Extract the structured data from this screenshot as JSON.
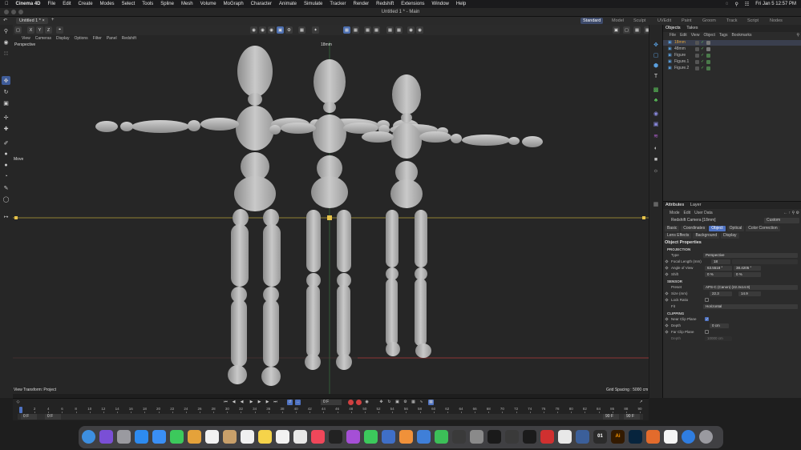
{
  "menubar": {
    "app_name": "Cinema 4D",
    "items": [
      "File",
      "Edit",
      "Create",
      "Modes",
      "Select",
      "Tools",
      "Spline",
      "Mesh",
      "Volume",
      "MoGraph",
      "Character",
      "Animate",
      "Simulate",
      "Tracker",
      "Render",
      "Redshift",
      "Extensions",
      "Window",
      "Help"
    ],
    "clock": "Fri Jan 5  12:57 PM"
  },
  "window": {
    "title": "Untitled 1 * - Main"
  },
  "doc_tab": {
    "label": "Untitled 1 *",
    "add": "+"
  },
  "layout_tabs": [
    "Standard",
    "Model",
    "Sculpt",
    "UVEdit",
    "Paint",
    "Groom",
    "Track",
    "Script",
    "Nodes"
  ],
  "active_layout": "Standard",
  "axis_buttons": [
    "X",
    "Y",
    "Z"
  ],
  "viewport_menu": [
    "View",
    "Cameras",
    "Display",
    "Options",
    "Filter",
    "Panel",
    "Redshift"
  ],
  "viewport": {
    "label": "Perspective",
    "camera_label": "18mm",
    "tool_label": "Move",
    "transform_label": "View Transform: Project",
    "grid_spacing": "Grid Spacing : 5000 cm"
  },
  "objects_panel": {
    "tabs": [
      "Objects",
      "Takes"
    ],
    "menu": [
      "File",
      "Edit",
      "View",
      "Object",
      "Tags",
      "Bookmarks"
    ],
    "items": [
      {
        "name": "18mm",
        "selected": true,
        "color": "#e0a33a"
      },
      {
        "name": "48mm",
        "selected": false,
        "color": "#bbbbbb"
      },
      {
        "name": "Figure",
        "selected": false,
        "color": "#bbbbbb"
      },
      {
        "name": "Figure.1",
        "selected": false,
        "color": "#bbbbbb"
      },
      {
        "name": "Figure.2",
        "selected": false,
        "color": "#bbbbbb"
      }
    ]
  },
  "attributes_panel": {
    "tabs": [
      "Attributes",
      "Layer"
    ],
    "menu": [
      "Mode",
      "Edit",
      "User Data"
    ],
    "object_title": "Redshift Camera [18mm]",
    "custom_select": "Custom",
    "property_tabs_row1": [
      "Basic",
      "Coordinates",
      "Object",
      "Optical",
      "Color Correction"
    ],
    "property_tabs_row2": [
      "Lens Effects",
      "Background",
      "Display"
    ],
    "active_tab": "Object",
    "section_title": "Object Properties",
    "projection": {
      "heading": "PROJECTION",
      "type_label": "Type",
      "type_value": "Perspective",
      "focal_label": "Focal Length (mm)",
      "focal_value": "18",
      "aov_label": "Angle of View",
      "aov_value_1": "63.5518 °",
      "aov_value_2": "38.4205 °",
      "shift_label": "Shift",
      "shift_value_1": "0 %",
      "shift_value_2": "0 %"
    },
    "sensor": {
      "heading": "SENSOR",
      "preset_label": "Preset",
      "preset_value": "APS-C (Canon) (22.3x14.9)",
      "size_label": "Size (mm)",
      "size_value_1": "22.3",
      "size_value_2": "14.9",
      "lock_label": "Lock Ratio",
      "fit_label": "Fit",
      "fit_value": "Horizontal"
    },
    "clipping": {
      "heading": "CLIPPING",
      "near_label": "Near Clip Plane",
      "depth_label": "Depth",
      "depth_value": "0 cm",
      "far_label": "Far Clip Plane",
      "far_depth_label": "Depth",
      "far_depth_value": "10000 cm"
    }
  },
  "timeline": {
    "current_frame": "0 F",
    "ticks": [
      "0",
      "2",
      "4",
      "6",
      "8",
      "10",
      "12",
      "14",
      "16",
      "18",
      "20",
      "22",
      "24",
      "26",
      "28",
      "30",
      "32",
      "34",
      "36",
      "38",
      "40",
      "42",
      "44",
      "46",
      "48",
      "50",
      "52",
      "54",
      "56",
      "58",
      "60",
      "62",
      "64",
      "66",
      "68",
      "70",
      "72",
      "74",
      "76",
      "78",
      "80",
      "82",
      "84",
      "86",
      "88",
      "90"
    ],
    "range_start_1": "0 F",
    "range_start_2": "0 F",
    "range_end_1": "90 F",
    "range_end_2": "90 F"
  },
  "dock": {
    "apps": [
      {
        "name": "finder",
        "color": "#3d8fe0"
      },
      {
        "name": "siri",
        "color": "#7a4fd6"
      },
      {
        "name": "launchpad",
        "color": "#9a9aa0"
      },
      {
        "name": "app-store",
        "color": "#2d8bf0"
      },
      {
        "name": "mail",
        "color": "#3a8ff5"
      },
      {
        "name": "messages",
        "color": "#3cc95c"
      },
      {
        "name": "photos",
        "color": "#e5a23a"
      },
      {
        "name": "calendar",
        "color": "#f2f2f2"
      },
      {
        "name": "contacts",
        "color": "#c9a06a"
      },
      {
        "name": "reminders",
        "color": "#f0f0f0"
      },
      {
        "name": "notes",
        "color": "#f5d34a"
      },
      {
        "name": "freeform",
        "color": "#f2f2f2"
      },
      {
        "name": "chrome",
        "color": "#e8e8e8"
      },
      {
        "name": "music",
        "color": "#f0475a"
      },
      {
        "name": "tv",
        "color": "#222222"
      },
      {
        "name": "podcasts",
        "color": "#a54fd6"
      },
      {
        "name": "facetime",
        "color": "#3cc95c"
      },
      {
        "name": "quicktime",
        "color": "#3f6fc7"
      },
      {
        "name": "pages",
        "color": "#f0913a"
      },
      {
        "name": "keynote",
        "color": "#3f7fd8"
      },
      {
        "name": "numbers",
        "color": "#3cbf58"
      },
      {
        "name": "activity-monitor",
        "color": "#3a3a3a"
      },
      {
        "name": "system-settings",
        "color": "#8a8a8a"
      },
      {
        "name": "terminal",
        "color": "#1a1a1a"
      },
      {
        "name": "console",
        "color": "#3a3a3a"
      },
      {
        "name": "cinema-4d",
        "color": "#1b1b1b"
      },
      {
        "name": "redshift",
        "color": "#d03030"
      },
      {
        "name": "slack",
        "color": "#e8e8e8"
      },
      {
        "name": "other-app",
        "color": "#3b5f9a"
      },
      {
        "name": "c4d-alt",
        "color": "#2b2b2b"
      },
      {
        "name": "illustrator",
        "color": "#331a00"
      },
      {
        "name": "photoshop",
        "color": "#07243d"
      },
      {
        "name": "color-app",
        "color": "#e36b2c"
      },
      {
        "name": "preview",
        "color": "#f5f5f5"
      },
      {
        "name": "globe-app",
        "color": "#2f7de0"
      },
      {
        "name": "trash",
        "color": "#9a9aa0"
      }
    ],
    "label_01": "01",
    "label_ai": "Ai"
  }
}
